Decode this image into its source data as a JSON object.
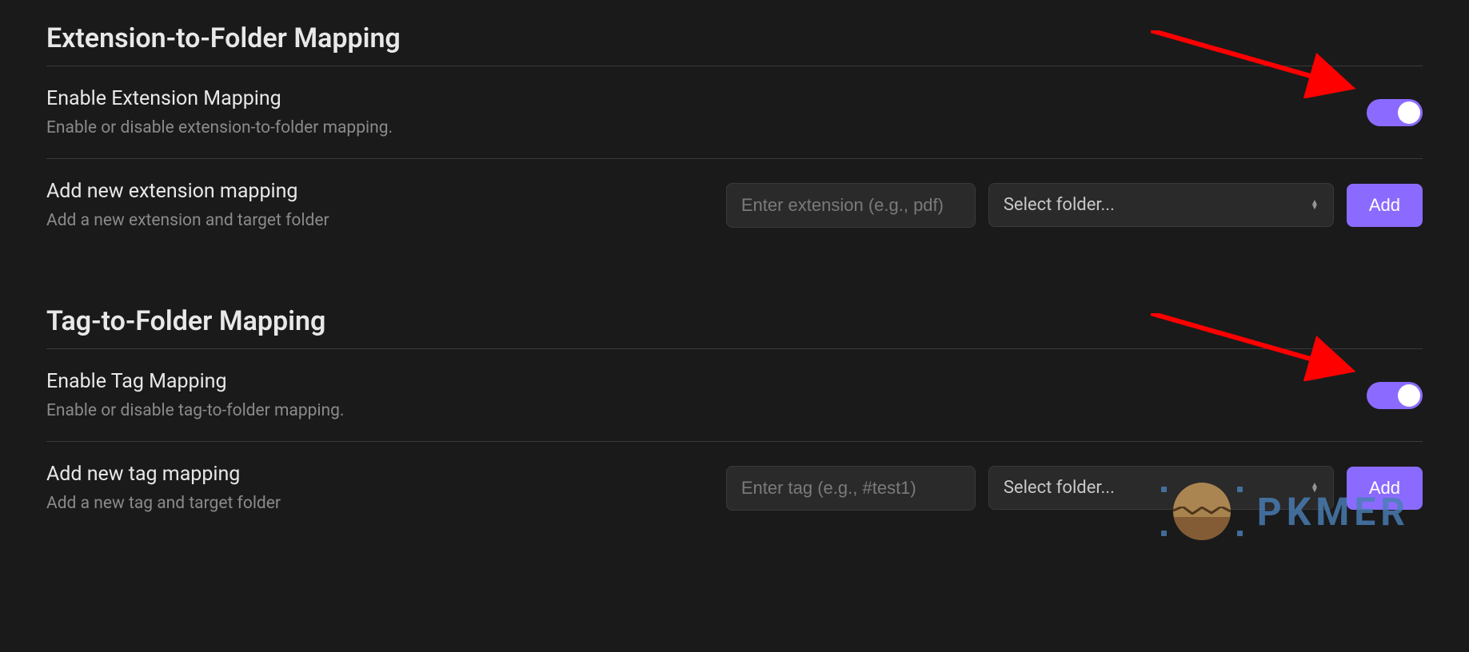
{
  "sections": {
    "extension": {
      "heading": "Extension-to-Folder Mapping",
      "enable": {
        "title": "Enable Extension Mapping",
        "description": "Enable or disable extension-to-folder mapping."
      },
      "add": {
        "title": "Add new extension mapping",
        "description": "Add a new extension and target folder",
        "input_placeholder": "Enter extension (e.g., pdf)",
        "select_label": "Select folder...",
        "button_label": "Add"
      }
    },
    "tag": {
      "heading": "Tag-to-Folder Mapping",
      "enable": {
        "title": "Enable Tag Mapping",
        "description": "Enable or disable tag-to-folder mapping."
      },
      "add": {
        "title": "Add new tag mapping",
        "description": "Add a new tag and target folder",
        "input_placeholder": "Enter tag (e.g., #test1)",
        "select_label": "Select folder...",
        "button_label": "Add"
      }
    }
  },
  "watermark": "PKMER"
}
